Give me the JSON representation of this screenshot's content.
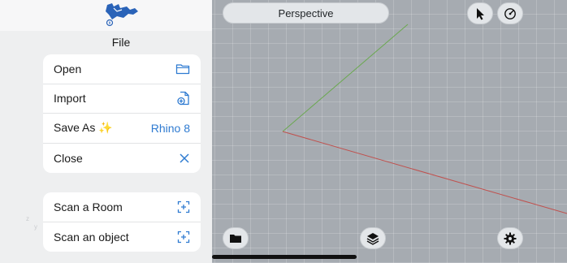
{
  "app": {
    "name": "Rhino",
    "logo_icon": "rhino-logo-icon"
  },
  "file_panel": {
    "title": "File",
    "main_actions": [
      {
        "label": "Open",
        "icon": "folder-icon"
      },
      {
        "label": "Import",
        "icon": "import-file-icon"
      },
      {
        "label": "Save As",
        "sparkle": "✨",
        "value": "Rhino 8"
      },
      {
        "label": "Close",
        "icon": "close-icon"
      }
    ],
    "scan_actions": [
      {
        "label": "Scan a Room",
        "icon": "scan-room-icon"
      },
      {
        "label": "Scan an object",
        "icon": "scan-object-icon"
      }
    ]
  },
  "viewport": {
    "title": "Perspective",
    "top_buttons": [
      "select-arrow-icon",
      "gumball-icon"
    ],
    "bottom_buttons": [
      "open-folder-icon",
      "layers-icon",
      "settings-icon"
    ],
    "colors": {
      "background": "#a6abb1",
      "x_axis": "#c0504d",
      "y_axis": "#6aa84f"
    },
    "axis_labels": [
      "z",
      "y"
    ]
  },
  "accent_color": "#2f7bd1"
}
